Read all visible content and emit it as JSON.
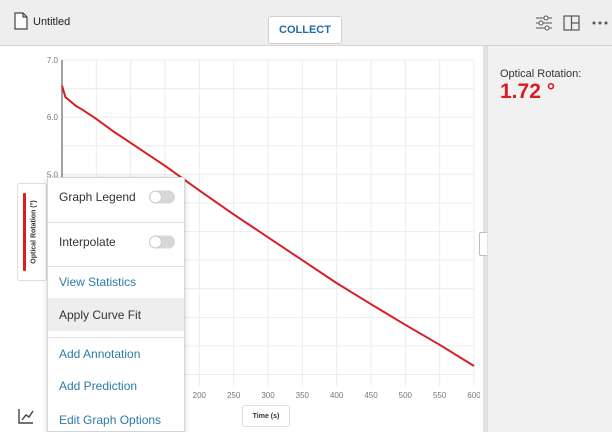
{
  "header": {
    "file_title": "Untitled",
    "collect_label": "COLLECT",
    "icons": [
      "file-icon",
      "sliders-icon",
      "layout-icon",
      "more-icon"
    ]
  },
  "meter": {
    "label": "Optical Rotation:",
    "value": "1.72 °",
    "color": "#d81e25"
  },
  "graph": {
    "y_axis_label": "Optical Rotation (°)",
    "x_axis_label": "Time (s)"
  },
  "menu": {
    "graph_legend": "Graph Legend",
    "interpolate": "Interpolate",
    "view_statistics": "View Statistics",
    "apply_curve_fit": "Apply Curve Fit",
    "add_annotation": "Add Annotation",
    "add_prediction": "Add Prediction",
    "edit_graph_options": "Edit Graph Options",
    "graph_legend_on": false,
    "interpolate_on": false
  },
  "chart_data": {
    "type": "line",
    "xlabel": "Time (s)",
    "ylabel": "Optical Rotation (°)",
    "xlim": [
      0,
      600
    ],
    "ylim": [
      1.3,
      7.0
    ],
    "x_ticks": [
      "200",
      "250",
      "300",
      "350",
      "400",
      "450",
      "500",
      "550",
      "600"
    ],
    "y_ticks": [
      "7.0",
      "6.0",
      "5.0"
    ],
    "grid": true,
    "series": [
      {
        "color": "#d81e25",
        "x": [
          0,
          5,
          10,
          15,
          20,
          30,
          50,
          75,
          100,
          150,
          200,
          250,
          300,
          350,
          400,
          450,
          500,
          550,
          600
        ],
        "y": [
          6.55,
          6.35,
          6.3,
          6.25,
          6.2,
          6.13,
          5.97,
          5.75,
          5.55,
          5.15,
          4.72,
          4.3,
          3.9,
          3.5,
          3.1,
          2.73,
          2.37,
          2.02,
          1.65
        ]
      }
    ]
  }
}
